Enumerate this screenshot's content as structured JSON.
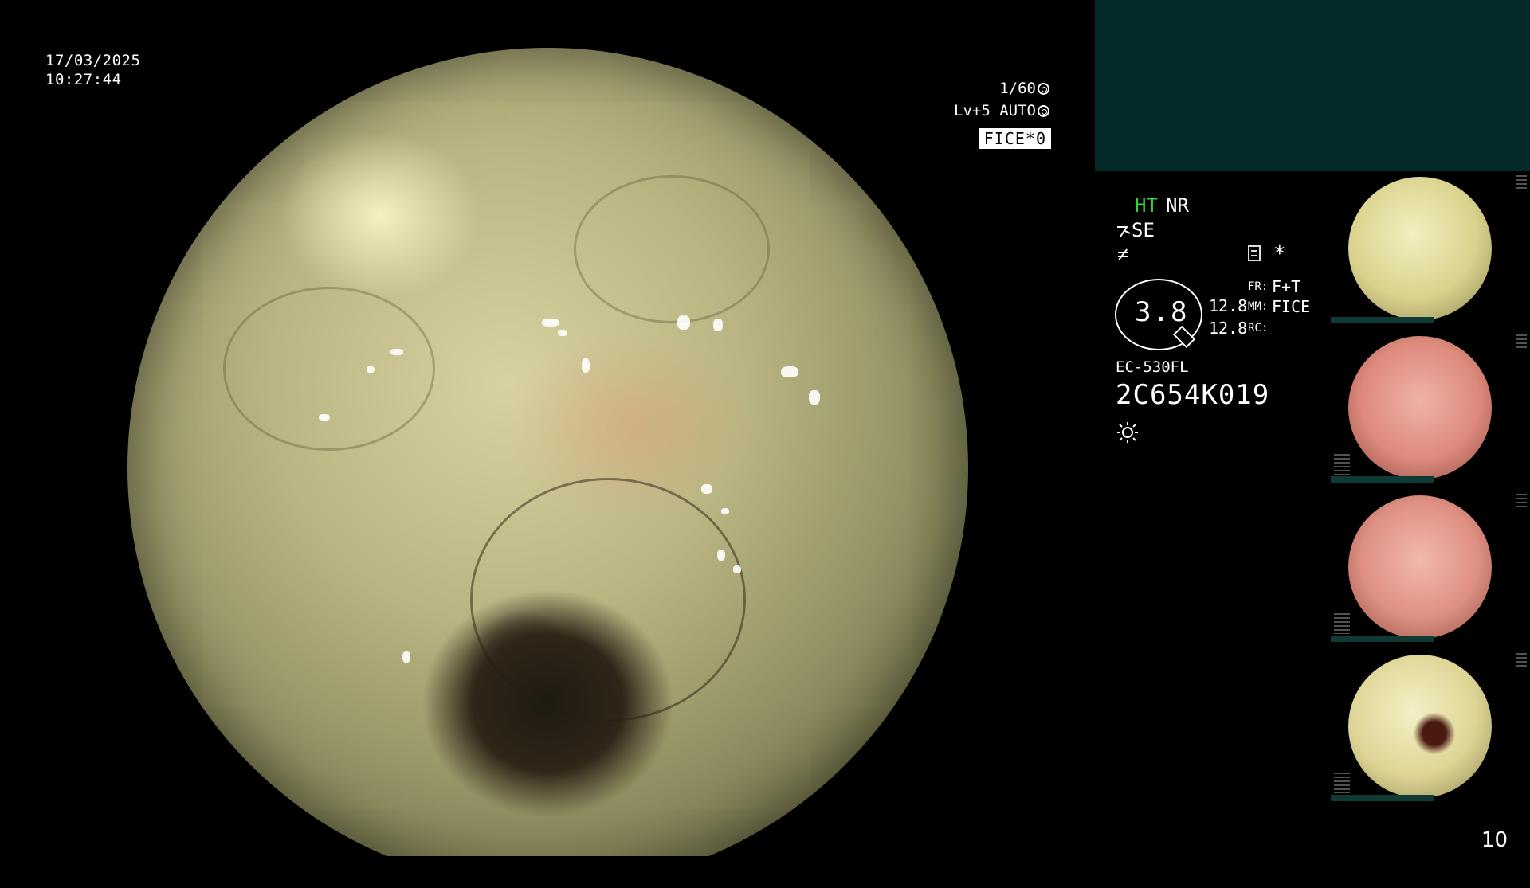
{
  "datetime": {
    "date": "17/03/2025",
    "time": "10:27:44"
  },
  "readouts": {
    "shutter": "1/60",
    "level": "Lv+5 AUTO",
    "mode_badge": "FICE*0"
  },
  "panel": {
    "ht": "HT",
    "nr": "NR",
    "se": "SE",
    "f_symbol": "≠",
    "asterisk": "*",
    "gauge_value": "3.8",
    "num_top": "12.8",
    "num_bottom": "12.8",
    "fr_label": "FR:",
    "fr_value": "F+T",
    "mm_label": "MM:",
    "mm_value": "FICE",
    "rc_label": "RC:",
    "model": "EC-530FL",
    "serial": "2C654K019"
  },
  "thumbnails": [
    {
      "name": "thumb-1",
      "tone": "yellow"
    },
    {
      "name": "thumb-2",
      "tone": "pink"
    },
    {
      "name": "thumb-3",
      "tone": "pink"
    },
    {
      "name": "thumb-4",
      "tone": "yellow"
    }
  ],
  "colors": {
    "ht_green": "#2bd93a",
    "teal_panel": "#032a28"
  },
  "page_number": "10"
}
